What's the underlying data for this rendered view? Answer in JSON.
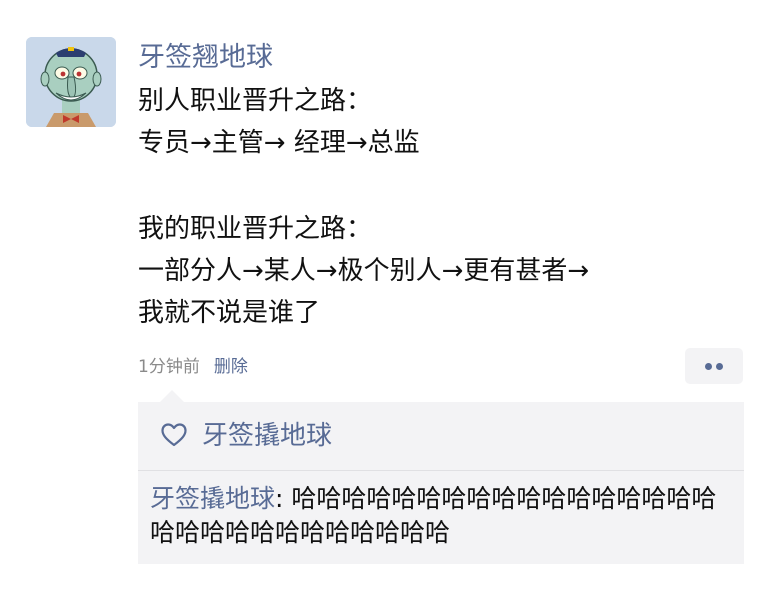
{
  "author": "牙签翘地球",
  "post": {
    "lines": [
      "别人职业晋升之路：",
      "专员→主管→ 经理→总监",
      "",
      "我的职业晋升之路：",
      "一部分人→某人→极个别人→更有甚者→",
      "我就不说是谁了"
    ]
  },
  "meta": {
    "time": "1分钟前",
    "delete_label": "删除"
  },
  "more_icon": "more-dots-icon",
  "likes": {
    "icon": "heart-outline-icon",
    "name": "牙签撬地球"
  },
  "comment": {
    "author": "牙签撬地球",
    "separator": ": ",
    "text": "哈哈哈哈哈哈哈哈哈哈哈哈哈哈哈哈哈哈哈哈哈哈哈哈哈哈哈哈哈"
  },
  "colors": {
    "link": "#586b95",
    "meta": "#8a8a8a",
    "panel": "#f3f3f5",
    "text": "#111111"
  }
}
